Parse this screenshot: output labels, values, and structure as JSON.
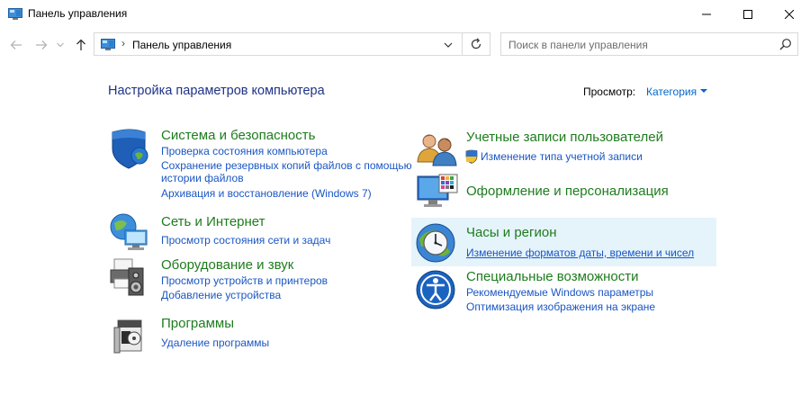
{
  "window": {
    "title": "Панель управления"
  },
  "address": {
    "crumb": "Панель управления"
  },
  "search": {
    "placeholder": "Поиск в панели управления"
  },
  "main": {
    "heading": "Настройка параметров компьютера",
    "view_by_label": "Просмотр:",
    "view_by_value": "Категория"
  },
  "left_categories": [
    {
      "title": "Система и безопасность",
      "icon": "shield-icon",
      "links": [
        "Проверка состояния компьютера",
        "Сохранение резервных копий файлов с помощью",
        "истории файлов",
        "Архивация и восстановление (Windows 7)"
      ]
    },
    {
      "title": "Сеть и Интернет",
      "icon": "network-globe-icon",
      "links": [
        "Просмотр состояния сети и задач"
      ]
    },
    {
      "title": "Оборудование и звук",
      "icon": "printer-speaker-icon",
      "links": [
        "Просмотр устройств и принтеров",
        "Добавление устройства"
      ]
    },
    {
      "title": "Программы",
      "icon": "programs-box-icon",
      "links": [
        "Удаление программы"
      ]
    }
  ],
  "right_categories": [
    {
      "title": "Учетные записи пользователей",
      "icon": "users-icon",
      "links": [
        "Изменение типа учетной записи"
      ]
    },
    {
      "title": "Оформление и персонализация",
      "icon": "monitor-palette-icon",
      "links": []
    },
    {
      "title": "Часы и регион",
      "icon": "clock-globe-icon",
      "links": [
        "Изменение форматов даты, времени и чисел"
      ]
    },
    {
      "title": "Специальные возможности",
      "icon": "accessibility-icon",
      "links": [
        "Рекомендуемые Windows параметры",
        "Оптимизация изображения на экране"
      ]
    }
  ],
  "colors": {
    "heading": "#1e3287",
    "category_title": "#1e7c1e",
    "link": "#1a56c4",
    "hover_bg": "#e5f3fb"
  }
}
